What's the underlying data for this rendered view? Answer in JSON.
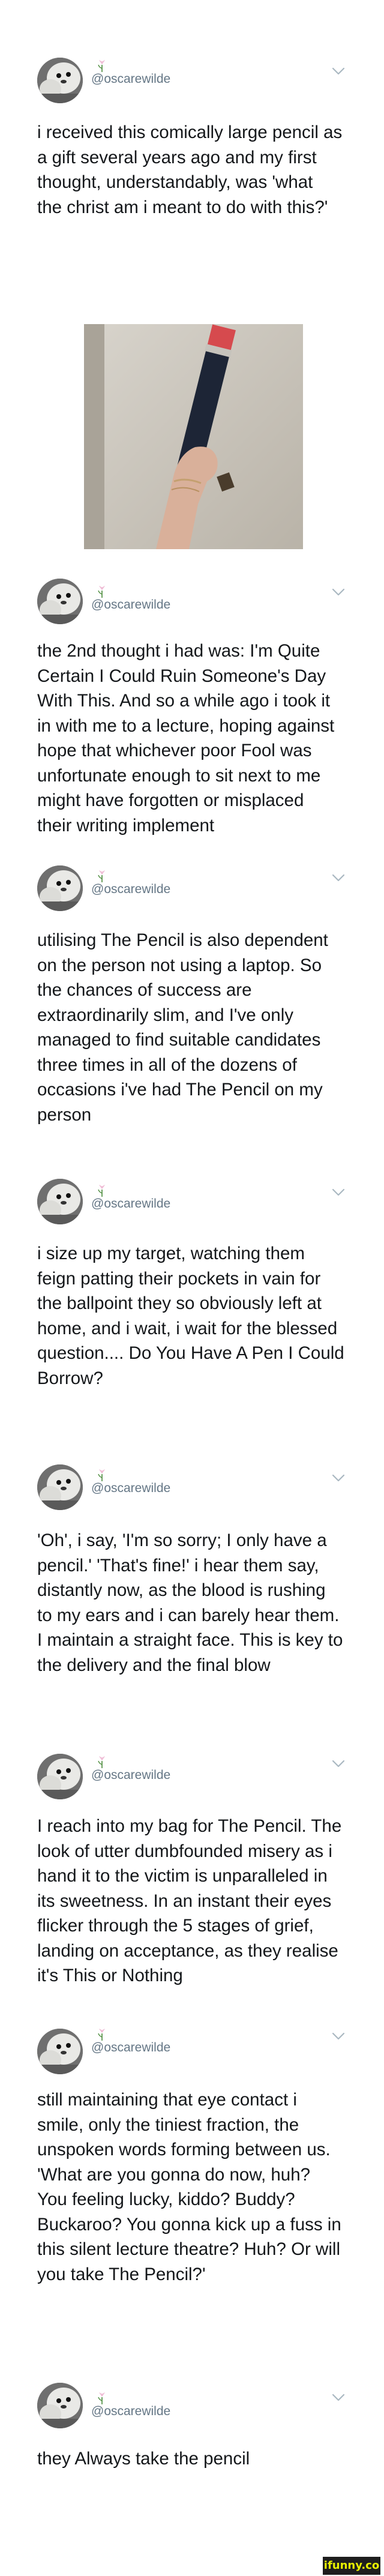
{
  "watermark": "ifunny.co",
  "image": {
    "description_icon": "pencil-photo"
  },
  "colors": {
    "handle": "#657786",
    "text": "#14171a",
    "chevron": "#aab8c2",
    "watermark_bg": "#1e1e1e",
    "watermark_fg": "#e8f000"
  },
  "tweets": [
    {
      "handle": "@oscarewilde",
      "text": "i received this comically large pencil as\na gift several years ago and my first\nthought, understandably, was 'what\nthe christ am i meant to do with this?'"
    },
    {
      "handle": "@oscarewilde",
      "text": "the 2nd thought i had was: I'm Quite\nCertain I Could Ruin Someone's Day\nWith This. And so a while ago i took it\nin with me to a lecture, hoping against\nhope that whichever poor Fool was\nunfortunate enough to sit next to me\nmight have forgotten or misplaced\ntheir writing implement"
    },
    {
      "handle": "@oscarewilde",
      "text": "utilising The Pencil is also dependent\non the person not using a laptop. So\nthe chances of success are\nextraordinarily slim, and I've only\nmanaged to find suitable candidates\nthree times in all of the dozens of\noccasions i've had The Pencil on my\nperson"
    },
    {
      "handle": "@oscarewilde",
      "text": "i size up my target, watching them\nfeign patting their pockets in vain for\nthe ballpoint they so obviously left at\nhome, and i wait, i wait for the blessed\nquestion.... Do You Have A Pen I Could\nBorrow?"
    },
    {
      "handle": "@oscarewilde",
      "text": "'Oh', i say, 'I'm so sorry; I only have a\npencil.' 'That's fine!' i hear them say,\ndistantly now, as the blood is rushing\nto my ears and i can barely hear them.\nI maintain a straight face. This is key to\nthe delivery and the final blow"
    },
    {
      "handle": "@oscarewilde",
      "text": "I reach into my bag for The Pencil. The\nlook of utter dumbfounded misery as i\nhand it to the victim is unparalleled in\nits sweetness. In an instant their eyes\nflicker through the 5 stages of grief,\nlanding on acceptance, as they realise\nit's This or Nothing"
    },
    {
      "handle": "@oscarewilde",
      "text": "still maintaining that eye contact i\nsmile, only the tiniest fraction, the\nunspoken words forming between us.\n'What are you gonna do now, huh?\nYou feeling lucky, kiddo? Buddy?\nBuckaroo? You gonna kick up a fuss in\nthis silent lecture theatre? Huh? Or will\nyou take The Pencil?'"
    },
    {
      "handle": "@oscarewilde",
      "text": "they Always take the pencil"
    }
  ]
}
